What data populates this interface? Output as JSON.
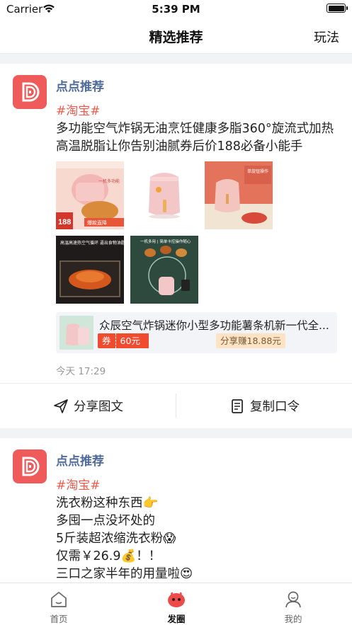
{
  "status": {
    "carrier": "Carrier",
    "time": "5:39 PM"
  },
  "nav": {
    "title": "精选推荐",
    "right": "玩法"
  },
  "posts": [
    {
      "author": "点点推荐",
      "tag": "#淘宝#",
      "text": "多功能空气炸锅无油烹饪健康多脂360°旋流式加热高温脱脂让你告别油腻券后价188必备小能手",
      "images": [
        {
          "badge": "188",
          "caption": "一机多功能",
          "tag": "爆款直降"
        },
        {
          "badge": "",
          "caption": "",
          "tag": ""
        },
        {
          "badge": "",
          "caption": "单旋钮操作",
          "tag": ""
        },
        {
          "badge": "",
          "caption": "高温高速热空气循环 逼出食物油脂进行烹饪",
          "tag": ""
        },
        {
          "badge": "",
          "caption": "一机多用 | 简单卡控操作随心",
          "tag": ""
        }
      ],
      "product": {
        "title": "众辰空气炸锅迷你小型多功能薯条机新一代全...",
        "coupon_label": "券",
        "coupon_value": "60元",
        "earn": "分享赚18.88元"
      },
      "time": "今天 17:29",
      "actions": {
        "share": "分享图文",
        "copy": "复制口令"
      }
    },
    {
      "author": "点点推荐",
      "tag": "#淘宝#",
      "lines": [
        "洗衣粉这种东西👉",
        "多囤一点没坏处的",
        "5斤装超浓缩洗衣粉😱",
        "仅需￥26.9💰！！",
        "三口之家半年的用量啦😍"
      ]
    }
  ],
  "tabs": [
    {
      "label": "首页",
      "icon": "home-icon",
      "active": false
    },
    {
      "label": "发圈",
      "icon": "circle-icon",
      "active": true
    },
    {
      "label": "我的",
      "icon": "profile-icon",
      "active": false
    }
  ],
  "colors": {
    "brand": "#ef5a5a",
    "author": "#4f6b99",
    "tag": "#ef5a4c",
    "coupon": "#f04a2f"
  }
}
